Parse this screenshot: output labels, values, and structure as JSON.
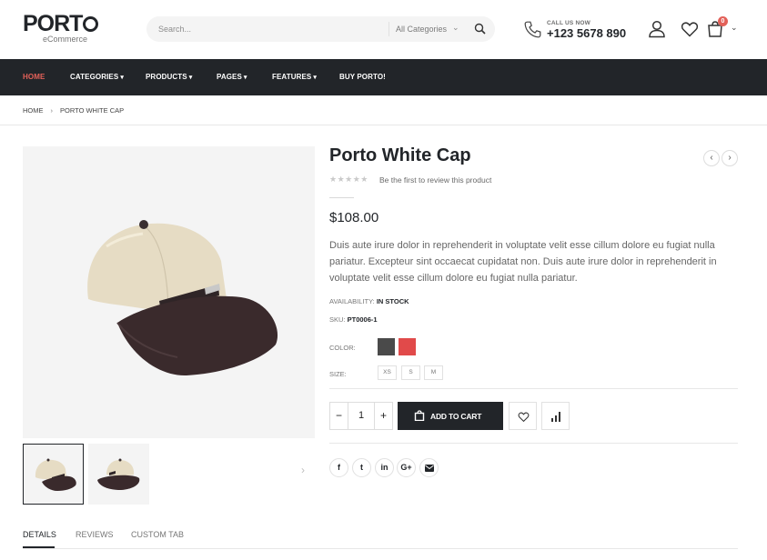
{
  "header": {
    "logo_text": "PORT",
    "logo_sub": "eCommerce",
    "search_placeholder": "Search...",
    "search_category": "All Categories",
    "call_label": "CALL US NOW",
    "call_number": "+123 5678 890",
    "cart_count": "0",
    "icons": [
      "phone-icon",
      "user-icon",
      "heart-icon",
      "cart-icon",
      "search-icon"
    ]
  },
  "nav": {
    "items": [
      {
        "label": "HOME",
        "active": true,
        "dropdown": false
      },
      {
        "label": "CATEGORIES",
        "active": false,
        "dropdown": true
      },
      {
        "label": "PRODUCTS",
        "active": false,
        "dropdown": true
      },
      {
        "label": "PAGES",
        "active": false,
        "dropdown": true
      },
      {
        "label": "FEATURES",
        "active": false,
        "dropdown": true
      },
      {
        "label": "BUY PORTO!",
        "active": false,
        "dropdown": false
      }
    ]
  },
  "breadcrumb": [
    "HOME",
    "PORTO WHITE CAP"
  ],
  "product": {
    "title": "Porto White Cap",
    "review_text": "Be the first to review this product",
    "rating": 0,
    "price": "$108.00",
    "description": "Duis aute irure dolor in reprehenderit in voluptate velit esse cillum dolore eu fugiat nulla pariatur. Excepteur sint occaecat cupidatat non. Duis aute irure dolor in reprehenderit in voluptate velit esse cillum dolore eu fugiat nulla pariatur.",
    "availability_label": "AVAILABILITY:",
    "availability_value": "IN STOCK",
    "sku_label": "SKU:",
    "sku_value": "PT0006-1",
    "color_label": "COLOR:",
    "colors": [
      "#4a4a4a",
      "#e14a4a"
    ],
    "size_label": "SIZE:",
    "sizes": [
      "XS",
      "S",
      "M"
    ],
    "quantity": "1",
    "add_to_cart": "ADD TO CART"
  },
  "social": [
    "f",
    "t",
    "in",
    "G+",
    "mail-icon"
  ],
  "tabs": [
    {
      "label": "DETAILS",
      "active": true
    },
    {
      "label": "REVIEWS",
      "active": false
    },
    {
      "label": "CUSTOM TAB",
      "active": false
    }
  ],
  "colors": {
    "accent": "#e36159",
    "dark": "#222529"
  }
}
